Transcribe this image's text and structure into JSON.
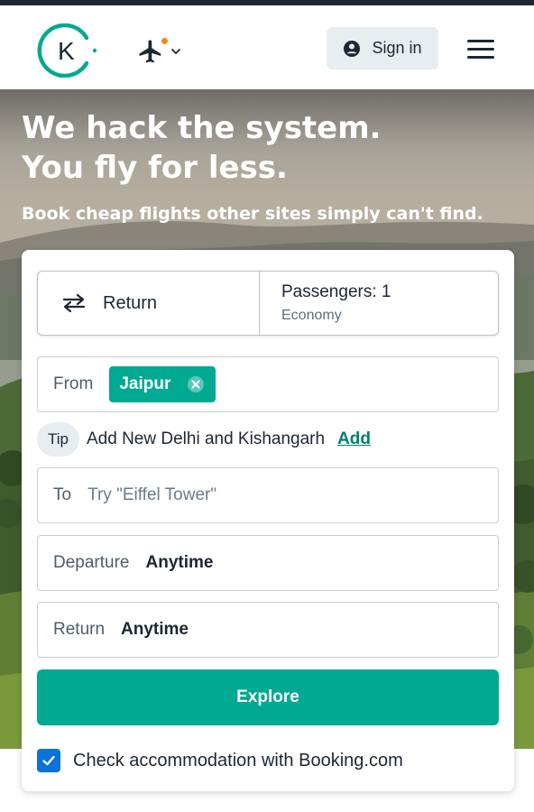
{
  "header": {
    "logo_letter": "K",
    "signin_label": "Sign in",
    "icons": [
      "kiwi-logo",
      "plane-icon",
      "chevron-down-icon",
      "user-icon",
      "hamburger-menu-icon"
    ]
  },
  "hero": {
    "headline_line1": "We hack the system.",
    "headline_line2": "You fly for less.",
    "subheadline": "Book cheap flights other sites simply can't find."
  },
  "search": {
    "trip_type": "Return",
    "passengers_label": "Passengers: 1",
    "cabin_class": "Economy",
    "from_label": "From",
    "from_value": "Jaipur",
    "tip_badge": "Tip",
    "tip_text": "Add New Delhi and Kishangarh",
    "tip_action": "Add",
    "to_label": "To",
    "to_placeholder": "Try \"Eiffel Tower\"",
    "departure_label": "Departure",
    "departure_value": "Anytime",
    "return_label": "Return",
    "return_value": "Anytime",
    "explore_label": "Explore",
    "accommodation_label": "Check accommodation with Booking.com",
    "accommodation_checked": true
  },
  "colors": {
    "brand_teal": "#00a991",
    "link_teal": "#00826b",
    "checkbox_blue": "#0b72d8",
    "dark_text": "#1c2733"
  }
}
